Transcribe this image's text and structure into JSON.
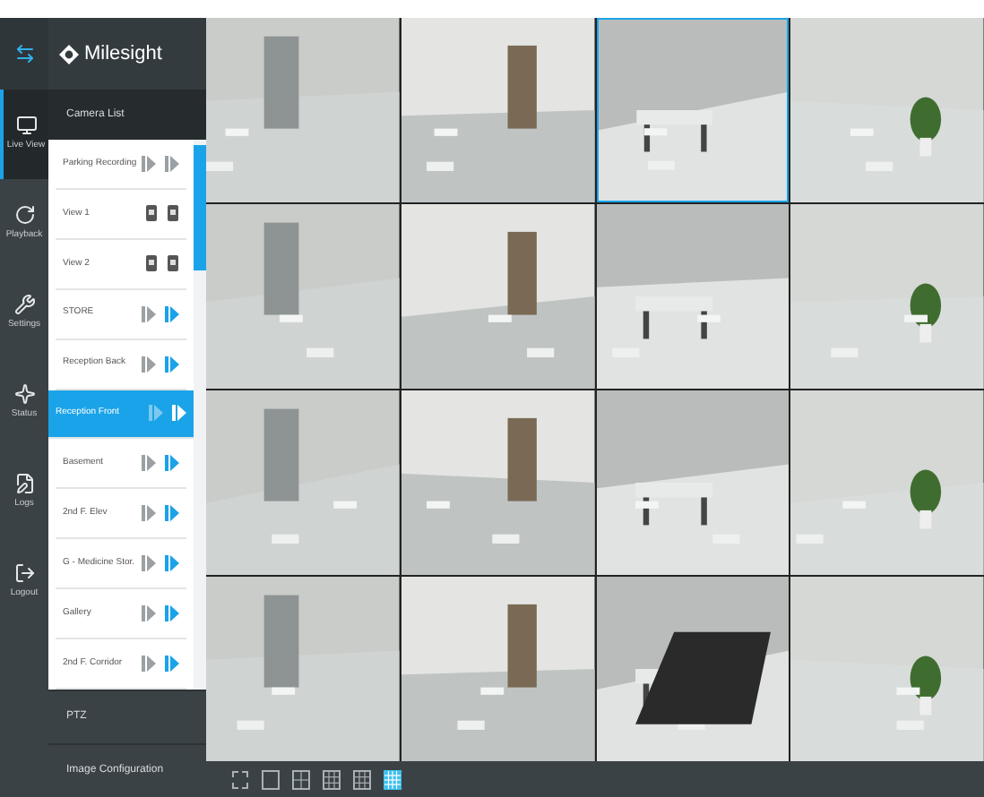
{
  "rail": [
    {
      "kind": "switch",
      "selected": false
    },
    {
      "kind": "live",
      "label": "Live View",
      "selected": true
    },
    {
      "kind": "playback",
      "label": "Playback",
      "selected": false
    },
    {
      "kind": "settings",
      "label": "Settings",
      "selected": false
    },
    {
      "kind": "status",
      "label": "Status",
      "selected": false
    },
    {
      "kind": "logs",
      "label": "Logs",
      "selected": false
    },
    {
      "kind": "logout",
      "label": "Logout",
      "selected": false
    }
  ],
  "brand": "Milesight",
  "panel": {
    "title": "Camera List",
    "items": [
      {
        "kind": "camera",
        "name": "Parking Recording",
        "live": false,
        "selected": false
      },
      {
        "kind": "view",
        "name": "View 1",
        "selected": false
      },
      {
        "kind": "view",
        "name": "View 2",
        "selected": false
      },
      {
        "kind": "camera",
        "name": "STORE",
        "live": true,
        "selected": false
      },
      {
        "kind": "camera",
        "name": "Reception Back",
        "live": true,
        "selected": false
      },
      {
        "kind": "camera",
        "name": "Reception Front",
        "live": true,
        "selected": true
      },
      {
        "kind": "camera",
        "name": "Basement",
        "live": true,
        "selected": false
      },
      {
        "kind": "camera",
        "name": "2nd F. Elev",
        "live": true,
        "selected": false
      },
      {
        "kind": "camera",
        "name": "G - Medicine Stor.",
        "live": true,
        "selected": false
      },
      {
        "kind": "camera",
        "name": "Gallery",
        "live": true,
        "selected": false
      },
      {
        "kind": "camera",
        "name": "2nd F. Corridor",
        "live": true,
        "selected": false
      }
    ],
    "sections": [
      "PTZ",
      "Image Configuration"
    ]
  },
  "tiles": [
    {
      "selected": false
    },
    {
      "selected": false
    },
    {
      "selected": true
    },
    {
      "selected": false
    },
    {
      "selected": false
    },
    {
      "selected": false
    },
    {
      "selected": false
    },
    {
      "selected": false
    },
    {
      "selected": false
    },
    {
      "selected": false
    },
    {
      "selected": false
    },
    {
      "selected": false
    },
    {
      "selected": false
    },
    {
      "selected": false
    },
    {
      "selected": false
    },
    {
      "selected": false
    }
  ],
  "layouts": [
    {
      "kind": "fullscreen",
      "selected": false
    },
    {
      "kind": "one",
      "selected": false
    },
    {
      "kind": "four",
      "selected": false
    },
    {
      "kind": "eight",
      "selected": false
    },
    {
      "kind": "nine",
      "selected": false
    },
    {
      "kind": "sixteen",
      "selected": true
    }
  ]
}
